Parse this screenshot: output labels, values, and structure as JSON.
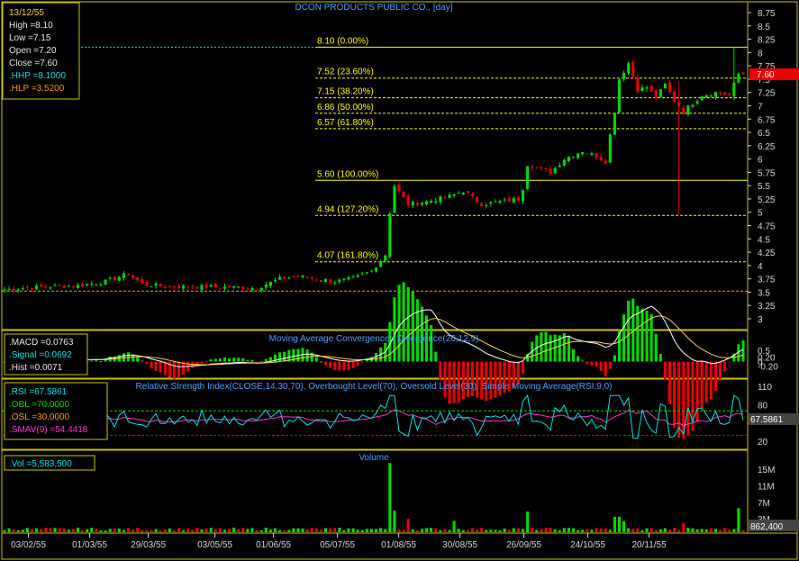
{
  "title": "DCON PRODUCTS PUBLIC CO., [day]",
  "colors": {
    "frame": "#c8c800",
    "up": "#00dd00",
    "down": "#ee0000",
    "fib": "#ffff00",
    "axis_text": "#d8d8d8",
    "title": "#4aa0ff",
    "cyan": "#00e5e5",
    "orange": "#ff9a00",
    "magenta": "#ff33cc",
    "current_price_bg": "#ee0000"
  },
  "info_box": {
    "date": "13/12/55",
    "high": "High =8.10",
    "low": "Low =7.15",
    "open": "Open =7.20",
    "close": "Close =7.60",
    "hhp": ".HHP =8.1000",
    "hlp": ".HLP =3.5200"
  },
  "price_axis_labels": [
    "8.75",
    "8.5",
    "8.25",
    "8",
    "7.75",
    "7.5",
    "7.25",
    "7",
    "6.75",
    "6.5",
    "6.25",
    "6",
    "5.75",
    "5.5",
    "5.25",
    "5",
    "4.75",
    "4.5",
    "4.25",
    "4",
    "3.75",
    "3.5",
    "3.25",
    "3"
  ],
  "current_price_tag": "7.60",
  "x_axis_labels": [
    "03/02/55",
    "01/03/55",
    "29/03/55",
    "03/05/55",
    "01/06/55",
    "05/07/55",
    "01/08/55",
    "30/08/55",
    "26/09/55",
    "24/10/55",
    "20/11/55"
  ],
  "macd": {
    "title": "Moving Average Convergence / Divergence(26,12,9)",
    "macd": ".MACD =0.0763",
    "signal": ".Signal =0.0692",
    "hist": ".Hist =0.0071",
    "axis_labels": [
      "0.5",
      "0.20",
      "0",
      "-0.20"
    ]
  },
  "rsi": {
    "title": "Relative Strength Index(CLOSE,14,30,70), Overbought Level(70), Oversold Level(30), Simple Moving Average(RSI,9,0)",
    "rsi": ".RSI =67.5861",
    "obl": ".OBL =70.0000",
    "osl": ".OSL =30.0000",
    "smav": ".SMAV(9) =54.4418",
    "axis_labels": [
      "110",
      "80",
      "20"
    ],
    "current_tag": "67.5861"
  },
  "volume": {
    "title": "Volume",
    "label": ".Vol =5,583,500",
    "axis_labels": [
      "15M",
      "11M",
      "7M",
      "3M"
    ],
    "current_tag": "862,400"
  },
  "chart_data": {
    "type": "candlestick",
    "title": "DCON PRODUCTS PUBLIC CO., [day]",
    "y_range": [
      3.0,
      8.75
    ],
    "fibonacci_levels": [
      {
        "label": "8.10 (0.00%)",
        "value": 8.1
      },
      {
        "label": "7.52 (23.60%)",
        "value": 7.52
      },
      {
        "label": "7.15 (38.20%)",
        "value": 7.15
      },
      {
        "label": "6.86 (50.00%)",
        "value": 6.86
      },
      {
        "label": "6.57 (61.80%)",
        "value": 6.57
      },
      {
        "label": "5.60 (100.00%)",
        "value": 5.6
      },
      {
        "label": "4.94 (127.20%)",
        "value": 4.94
      },
      {
        "label": "4.07 (161.80%)",
        "value": 4.07
      }
    ],
    "hlp_level": 3.52,
    "close_path": [
      {
        "d": 0,
        "c": 3.55
      },
      {
        "d": 8,
        "c": 3.6
      },
      {
        "d": 16,
        "c": 3.62
      },
      {
        "d": 22,
        "c": 3.7
      },
      {
        "d": 27,
        "c": 3.85
      },
      {
        "d": 30,
        "c": 3.65
      },
      {
        "d": 36,
        "c": 3.6
      },
      {
        "d": 45,
        "c": 3.6
      },
      {
        "d": 55,
        "c": 3.58
      },
      {
        "d": 60,
        "c": 3.75
      },
      {
        "d": 64,
        "c": 3.8
      },
      {
        "d": 68,
        "c": 3.75
      },
      {
        "d": 72,
        "c": 3.7
      },
      {
        "d": 76,
        "c": 3.75
      },
      {
        "d": 80,
        "c": 3.9
      },
      {
        "d": 83,
        "c": 4.2
      },
      {
        "d": 84,
        "c": 5.0
      },
      {
        "d": 85,
        "c": 5.5
      },
      {
        "d": 88,
        "c": 5.15
      },
      {
        "d": 92,
        "c": 5.2
      },
      {
        "d": 97,
        "c": 5.3
      },
      {
        "d": 100,
        "c": 5.4
      },
      {
        "d": 104,
        "c": 5.15
      },
      {
        "d": 108,
        "c": 5.2
      },
      {
        "d": 112,
        "c": 5.25
      },
      {
        "d": 113,
        "c": 5.45
      },
      {
        "d": 114,
        "c": 5.9
      },
      {
        "d": 117,
        "c": 5.8
      },
      {
        "d": 119,
        "c": 5.75
      },
      {
        "d": 122,
        "c": 6.0
      },
      {
        "d": 126,
        "c": 6.15
      },
      {
        "d": 129,
        "c": 6.05
      },
      {
        "d": 131,
        "c": 5.95
      },
      {
        "d": 132,
        "c": 6.45
      },
      {
        "d": 133,
        "c": 6.9
      },
      {
        "d": 134,
        "c": 7.5
      },
      {
        "d": 136,
        "c": 7.8
      },
      {
        "d": 138,
        "c": 7.3
      },
      {
        "d": 140,
        "c": 7.35
      },
      {
        "d": 142,
        "c": 7.15
      },
      {
        "d": 144,
        "c": 7.4
      },
      {
        "d": 146,
        "c": 7.1
      },
      {
        "d": 148,
        "c": 6.9
      },
      {
        "d": 150,
        "c": 7.05
      },
      {
        "d": 152,
        "c": 7.2
      },
      {
        "d": 155,
        "c": 7.25
      },
      {
        "d": 158,
        "c": 7.2
      },
      {
        "d": 160,
        "c": 7.6
      }
    ],
    "gaps": [
      [
        113,
        114
      ],
      [
        131,
        132
      ]
    ],
    "wick_extremes": [
      {
        "d": 147,
        "low": 4.95,
        "high": 7.45
      },
      {
        "d": 159,
        "low": 7.1,
        "high": 8.1
      }
    ],
    "rsi_levels": {
      "overbought": 70,
      "oversold": 30,
      "rsi": 67.5861,
      "smav": 54.4418
    },
    "macd_values": {
      "macd": 0.0763,
      "signal": 0.0692,
      "hist": 0.0071
    },
    "volume_spikes": [
      {
        "d": 84,
        "volume": 16500000
      },
      {
        "d": 85,
        "volume": 5000000
      },
      {
        "d": 88,
        "volume": 3000000
      },
      {
        "d": 98,
        "volume": 2500000
      },
      {
        "d": 114,
        "volume": 4800000
      },
      {
        "d": 133,
        "volume": 3500000
      },
      {
        "d": 134,
        "volume": 3500000
      },
      {
        "d": 135,
        "volume": 2500000
      },
      {
        "d": 148,
        "volume": 2000000
      },
      {
        "d": 160,
        "volume": 5583500
      }
    ],
    "x_labels": [
      "03/02/55",
      "01/03/55",
      "29/03/55",
      "03/05/55",
      "01/06/55",
      "05/07/55",
      "01/08/55",
      "30/08/55",
      "26/09/55",
      "24/10/55",
      "20/11/55"
    ]
  }
}
